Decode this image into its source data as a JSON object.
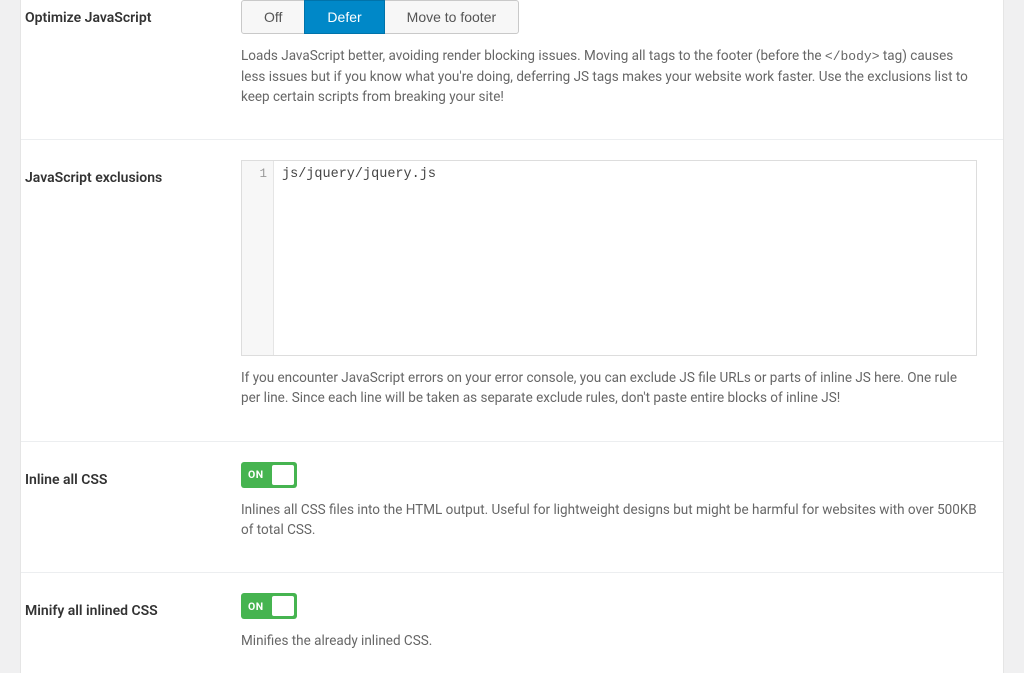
{
  "optimize_js": {
    "label": "Optimize JavaScript",
    "options": {
      "off": "Off",
      "defer": "Defer",
      "footer": "Move to footer"
    },
    "desc_pre": "Loads JavaScript better, avoiding render blocking issues. Moving all tags to the footer (before the ",
    "desc_tag": "</body>",
    "desc_post": " tag) causes less issues but if you know what you're doing, deferring JS tags makes your website work faster. Use the exclusions list to keep certain scripts from breaking your site!"
  },
  "js_exclusions": {
    "label": "JavaScript exclusions",
    "line_no": "1",
    "content": "js/jquery/jquery.js",
    "desc": "If you encounter JavaScript errors on your error console, you can exclude JS file URLs or parts of inline JS here. One rule per line. Since each line will be taken as separate exclude rules, don't paste entire blocks of inline JS!"
  },
  "inline_css": {
    "label": "Inline all CSS",
    "toggle_text": "ON",
    "desc": "Inlines all CSS files into the HTML output. Useful for lightweight designs but might be harmful for websites with over 500KB of total CSS."
  },
  "minify_css": {
    "label": "Minify all inlined CSS",
    "toggle_text": "ON",
    "desc": "Minifies the already inlined CSS."
  }
}
